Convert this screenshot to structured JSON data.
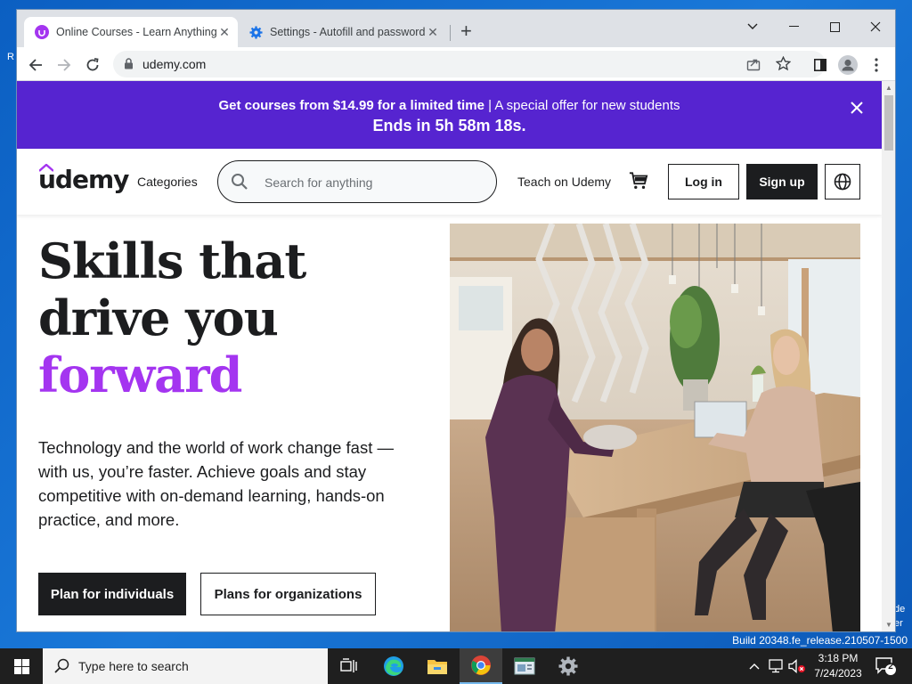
{
  "browser": {
    "tabs": [
      {
        "title": "Online Courses - Learn Anything",
        "active": true
      },
      {
        "title": "Settings - Autofill and passwords",
        "active": false
      }
    ],
    "url": "udemy.com"
  },
  "promo": {
    "bold_text": "Get courses from $14.99 for a limited time",
    "separator": " | ",
    "rest_text": "A special offer for new students",
    "countdown": "Ends in 5h 58m 18s."
  },
  "header": {
    "logo": "udemy",
    "categories": "Categories",
    "search_placeholder": "Search for anything",
    "teach": "Teach on Udemy",
    "login": "Log in",
    "signup": "Sign up"
  },
  "hero": {
    "title_line1": "Skills that",
    "title_line2": "drive you",
    "title_line3": "forward",
    "body": "Technology and the world of work change fast — with us, you’re faster. Achieve goals and stay competitive with on-demand learning, hands-on practice, and more.",
    "btn_individuals": "Plan for individuals",
    "btn_organizations": "Plans for organizations"
  },
  "desktop": {
    "build": "Build 20348.fe_release.210507-1500"
  },
  "taskbar": {
    "search_text": "Type here to search",
    "time": "3:18 PM",
    "date": "7/24/2023",
    "notification_count": "2"
  },
  "colors": {
    "promo_bg": "#5624d0",
    "accent_purple": "#a435f0",
    "text_dark": "#1c1d1f"
  }
}
